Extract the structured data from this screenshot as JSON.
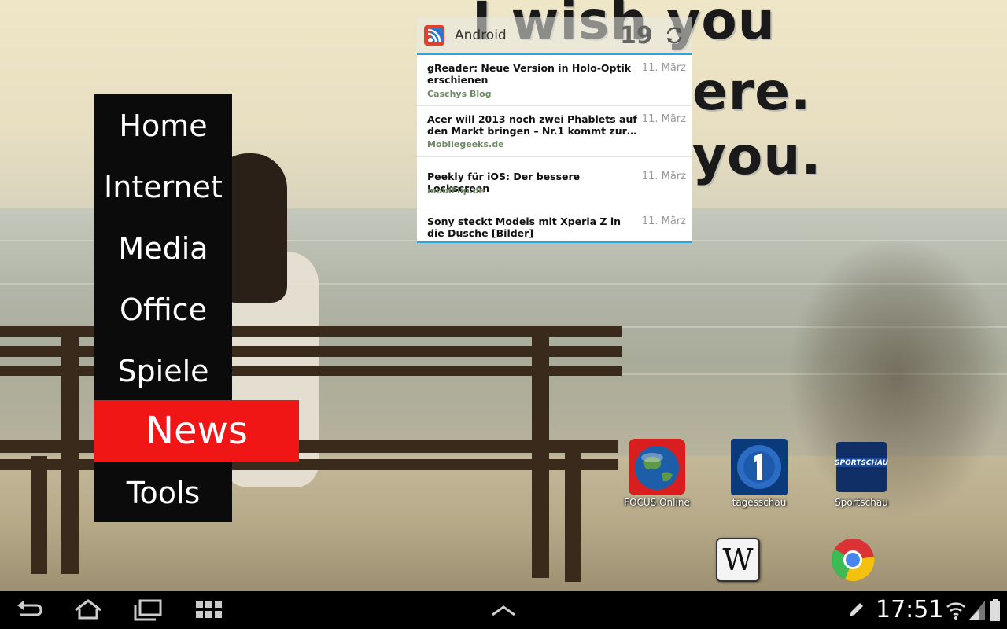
{
  "wallpaper": {
    "quote_lines": [
      "I wish you",
      "ere.",
      "you."
    ]
  },
  "side_menu": {
    "items": [
      {
        "label": "Home"
      },
      {
        "label": "Internet"
      },
      {
        "label": "Media"
      },
      {
        "label": "Office"
      },
      {
        "label": "Spiele"
      },
      {
        "label": "News",
        "active": true
      },
      {
        "label": "Tools"
      }
    ],
    "active_color": "#f01616"
  },
  "widget": {
    "title": "Android",
    "unread_count": "19",
    "articles": [
      {
        "title": "gReader: Neue Version in Holo-Optik erschienen",
        "date": "11. März",
        "source": "Caschys Blog"
      },
      {
        "title": "Acer will 2013 noch zwei Phablets auf den Markt bringen – Nr.1 kommt zur…",
        "date": "11. März",
        "source": "Mobilegeeks.de"
      },
      {
        "title": "Peekly für iOS: Der bessere Lockscreen",
        "date": "11. März",
        "source": "mobiFlip.de"
      },
      {
        "title": "Sony steckt Models mit Xperia Z in die Dusche [Bilder]",
        "date": "11. März",
        "source": ""
      }
    ],
    "accent_color": "#2fa3dc"
  },
  "apps": [
    {
      "label": "FOCUS Online",
      "icon": "focus-online-icon"
    },
    {
      "label": "tagesschau",
      "icon": "tagesschau-icon"
    },
    {
      "label": "Sportschau",
      "icon": "sportschau-icon",
      "badge_text": "SPORTSCHAU"
    },
    {
      "label": "",
      "icon": "wikipedia-icon",
      "glyph": "W"
    },
    {
      "label": "",
      "icon": "chrome-icon"
    }
  ],
  "system_bar": {
    "time": "17:51",
    "nav_icons": [
      "back-icon",
      "home-icon",
      "recent-apps-icon",
      "screenshot-grid-icon",
      "chevron-up-icon"
    ],
    "status_icons": [
      "pen-icon",
      "wifi-icon",
      "signal-icon",
      "battery-icon"
    ]
  }
}
